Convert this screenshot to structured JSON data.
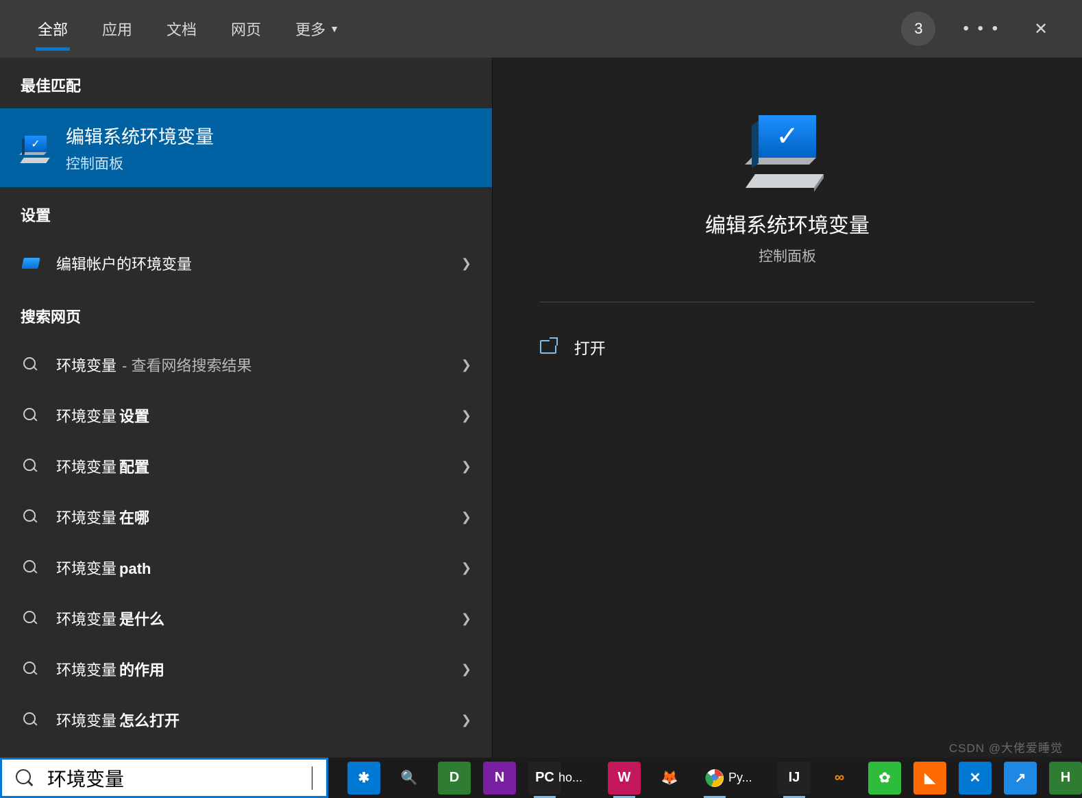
{
  "tabs": {
    "all": "全部",
    "apps": "应用",
    "docs": "文档",
    "web": "网页",
    "more": "更多"
  },
  "badge": "3",
  "sections": {
    "best": "最佳匹配",
    "settings": "设置",
    "web": "搜索网页"
  },
  "best": {
    "title": "编辑系统环境变量",
    "sub": "控制面板"
  },
  "settings_items": [
    {
      "label": "编辑帐户的环境变量"
    }
  ],
  "web_items": [
    {
      "prefix": "环境变量",
      "bold": "",
      "suffix": " - 查看网络搜索结果"
    },
    {
      "prefix": "环境变量",
      "bold": "设置",
      "suffix": ""
    },
    {
      "prefix": "环境变量",
      "bold": "配置",
      "suffix": ""
    },
    {
      "prefix": "环境变量",
      "bold": "在哪",
      "suffix": ""
    },
    {
      "prefix": "环境变量",
      "bold": "path",
      "suffix": ""
    },
    {
      "prefix": "环境变量",
      "bold": "是什么",
      "suffix": ""
    },
    {
      "prefix": "环境变量",
      "bold": "的作用",
      "suffix": ""
    },
    {
      "prefix": "环境变量",
      "bold": "怎么打开",
      "suffix": ""
    }
  ],
  "right": {
    "title": "编辑系统环境变量",
    "sub": "控制面板",
    "open": "打开"
  },
  "search": {
    "value": "环境变量"
  },
  "taskbar": [
    {
      "bg": "#0078d4",
      "txt": "✱"
    },
    {
      "bg": "transparent",
      "txt": "🔍",
      "color": "#e38b1a"
    },
    {
      "bg": "#2e7d32",
      "txt": "D"
    },
    {
      "bg": "#7b1fa2",
      "txt": "N"
    },
    {
      "bg": "#222",
      "txt": "PC",
      "label": "ho...",
      "under": true
    },
    {
      "bg": "#c2185b",
      "txt": "W",
      "under": true
    },
    {
      "bg": "transparent",
      "txt": "🦊"
    },
    {
      "bg": "transparent",
      "txt": "◯",
      "label": "Py...",
      "under": true,
      "chrome": true
    },
    {
      "bg": "#222",
      "txt": "IJ",
      "under": true
    },
    {
      "bg": "transparent",
      "txt": "∞",
      "color": "#ff8a00"
    },
    {
      "bg": "#2dbd3a",
      "txt": "✿"
    },
    {
      "bg": "#ff6a00",
      "txt": "◣"
    },
    {
      "bg": "#0078d4",
      "txt": "✕"
    },
    {
      "bg": "#1e88e5",
      "txt": "↗"
    },
    {
      "bg": "#2e7d32",
      "txt": "H"
    }
  ],
  "watermark": "CSDN @大佬爱睡觉"
}
